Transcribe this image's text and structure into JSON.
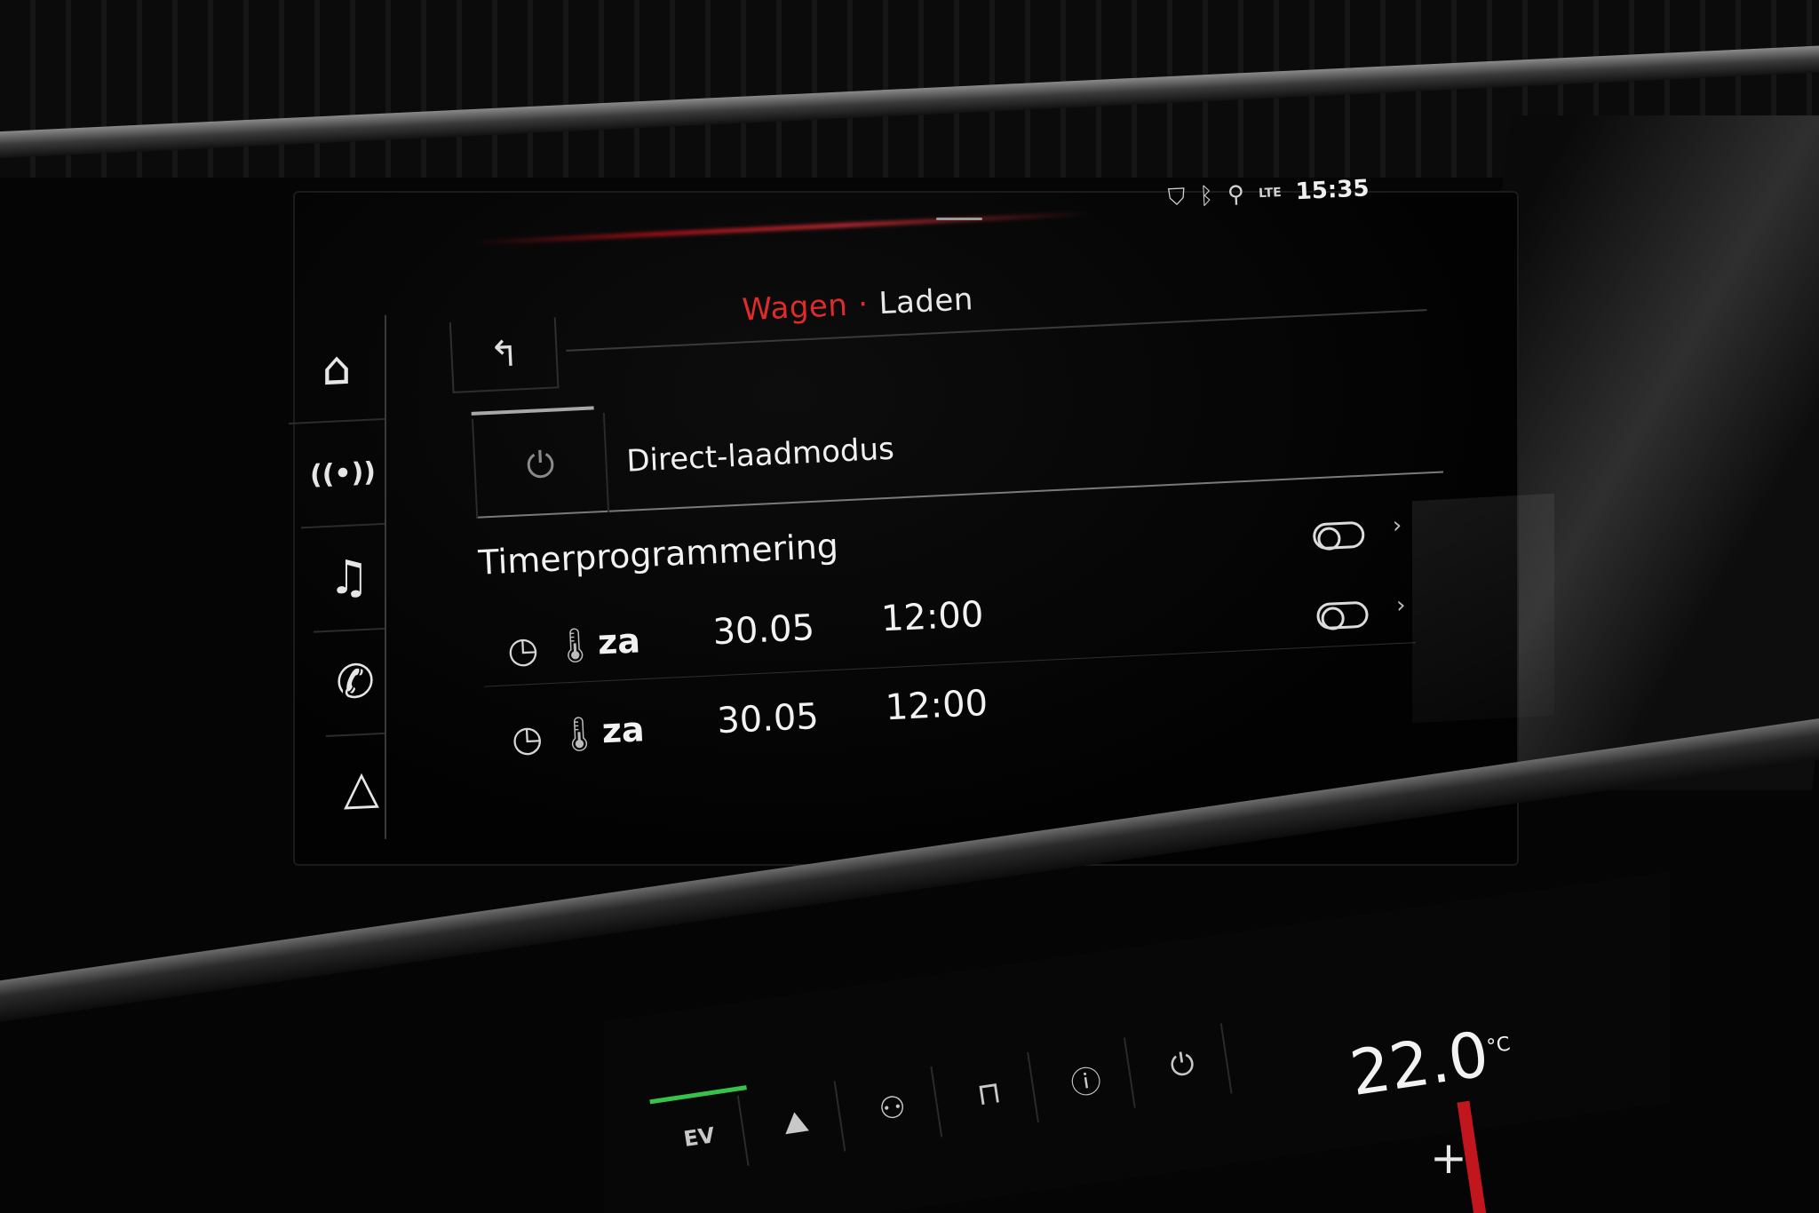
{
  "status_bar": {
    "location_icon": "location-shield-icon",
    "bluetooth_icon": "bluetooth-icon",
    "user_icon": "user-icon",
    "network_label": "LTE",
    "time": "15:35"
  },
  "nav": {
    "items": [
      {
        "icon": "home-icon",
        "glyph": "⌂"
      },
      {
        "icon": "radio-icon",
        "glyph": "((•))"
      },
      {
        "icon": "music-icon",
        "glyph": "♫"
      },
      {
        "icon": "phone-icon",
        "glyph": "✆"
      },
      {
        "icon": "navigation-icon",
        "glyph": "△"
      }
    ]
  },
  "breadcrumb": {
    "parent": "Wagen",
    "separator": "·",
    "current": "Laden"
  },
  "back_button": {
    "icon": "back-arrow-icon",
    "glyph": "↰"
  },
  "charge_mode": {
    "icon": "charging-plug-icon",
    "label": "Direct-laadmodus"
  },
  "timers": {
    "title": "Timerprogrammering",
    "rows": [
      {
        "icon": "timer-1-icon",
        "day": "za",
        "date": "30.05",
        "time": "12:00",
        "enabled": false
      },
      {
        "icon": "timer-2-icon",
        "day": "za",
        "date": "30.05",
        "time": "12:00",
        "enabled": false
      }
    ]
  },
  "climate": {
    "ev_label": "EV",
    "temperature": "22.0",
    "temperature_unit": "°C",
    "accent_color": "#37c24a"
  },
  "colors": {
    "breadcrumb_active": "#e02b2b",
    "text": "#e8e8e8",
    "background": "#020202"
  }
}
